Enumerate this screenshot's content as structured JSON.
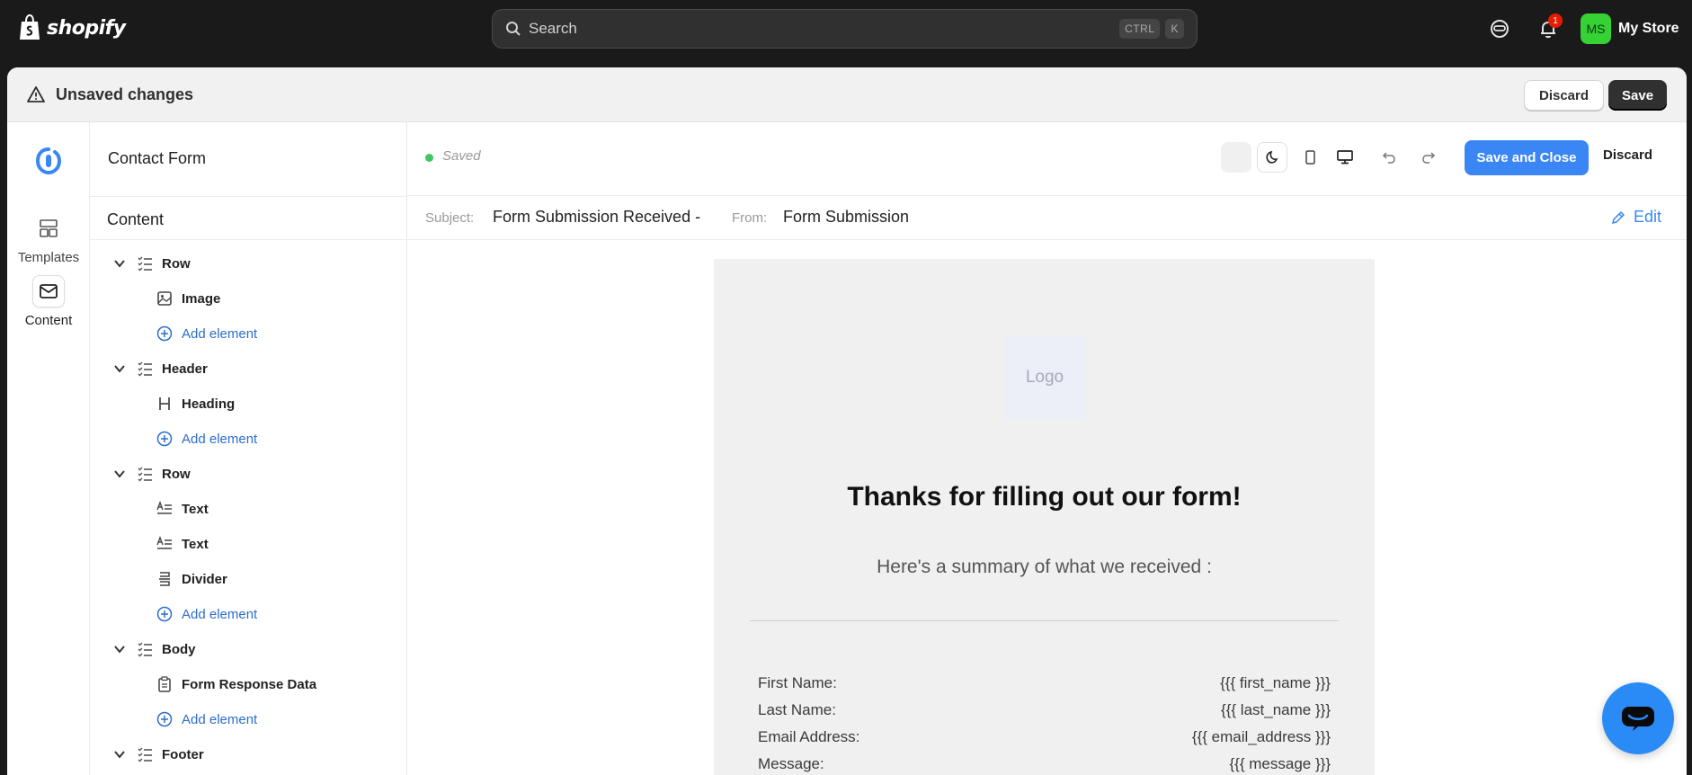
{
  "topbar": {
    "brand": "shopify",
    "search": {
      "placeholder": "Search",
      "shortcut_modifier": "CTRL",
      "shortcut_key": "K"
    },
    "notifications_count": "1",
    "store": {
      "initials": "MS",
      "name": "My Store"
    }
  },
  "unsaved_bar": {
    "title": "Unsaved changes",
    "discard_label": "Discard",
    "save_label": "Save"
  },
  "rail": {
    "items": [
      {
        "label": "Templates",
        "icon": "templates-icon"
      },
      {
        "label": "Content",
        "icon": "envelope-icon",
        "active": true
      }
    ]
  },
  "panel": {
    "title": "Contact Form",
    "section": "Content",
    "tree": [
      {
        "label": "Row",
        "type": "group"
      },
      {
        "label": "Image",
        "type": "leaf",
        "icon": "image-icon"
      },
      {
        "label": "Add element",
        "type": "add"
      },
      {
        "label": "Header",
        "type": "group"
      },
      {
        "label": "Heading",
        "type": "leaf",
        "icon": "heading-icon"
      },
      {
        "label": "Add element",
        "type": "add"
      },
      {
        "label": "Row",
        "type": "group"
      },
      {
        "label": "Text",
        "type": "leaf",
        "icon": "text-icon"
      },
      {
        "label": "Text",
        "type": "leaf",
        "icon": "text-icon"
      },
      {
        "label": "Divider",
        "type": "leaf",
        "icon": "divider-icon"
      },
      {
        "label": "Add element",
        "type": "add"
      },
      {
        "label": "Body",
        "type": "group"
      },
      {
        "label": "Form Response Data",
        "type": "leaf",
        "icon": "clipboard-icon"
      },
      {
        "label": "Add element",
        "type": "add"
      },
      {
        "label": "Footer",
        "type": "group"
      }
    ]
  },
  "editor": {
    "status": "Saved",
    "save_close_label": "Save and Close",
    "discard_label": "Discard",
    "subject_label": "Subject:",
    "subject_value": "Form Submission Received -",
    "from_label": "From:",
    "from_value": "Form Submission",
    "edit_label": "Edit"
  },
  "email": {
    "logo_placeholder": "Logo",
    "heading": "Thanks for filling out our form!",
    "subheading": "Here's a summary of what we received :",
    "fields": [
      {
        "label": "First Name:",
        "value": "{{{ first_name }}}"
      },
      {
        "label": "Last Name:",
        "value": "{{{ last_name }}}"
      },
      {
        "label": "Email Address:",
        "value": "{{{ email_address }}}"
      },
      {
        "label": "Message:",
        "value": "{{{ message }}}"
      }
    ]
  },
  "colors": {
    "accent": "#3a86f5",
    "topbar_bg": "#1a1a1a",
    "saved_dot": "#3dc763",
    "avatar_bg": "#36d135",
    "badge": "#e51c00"
  }
}
